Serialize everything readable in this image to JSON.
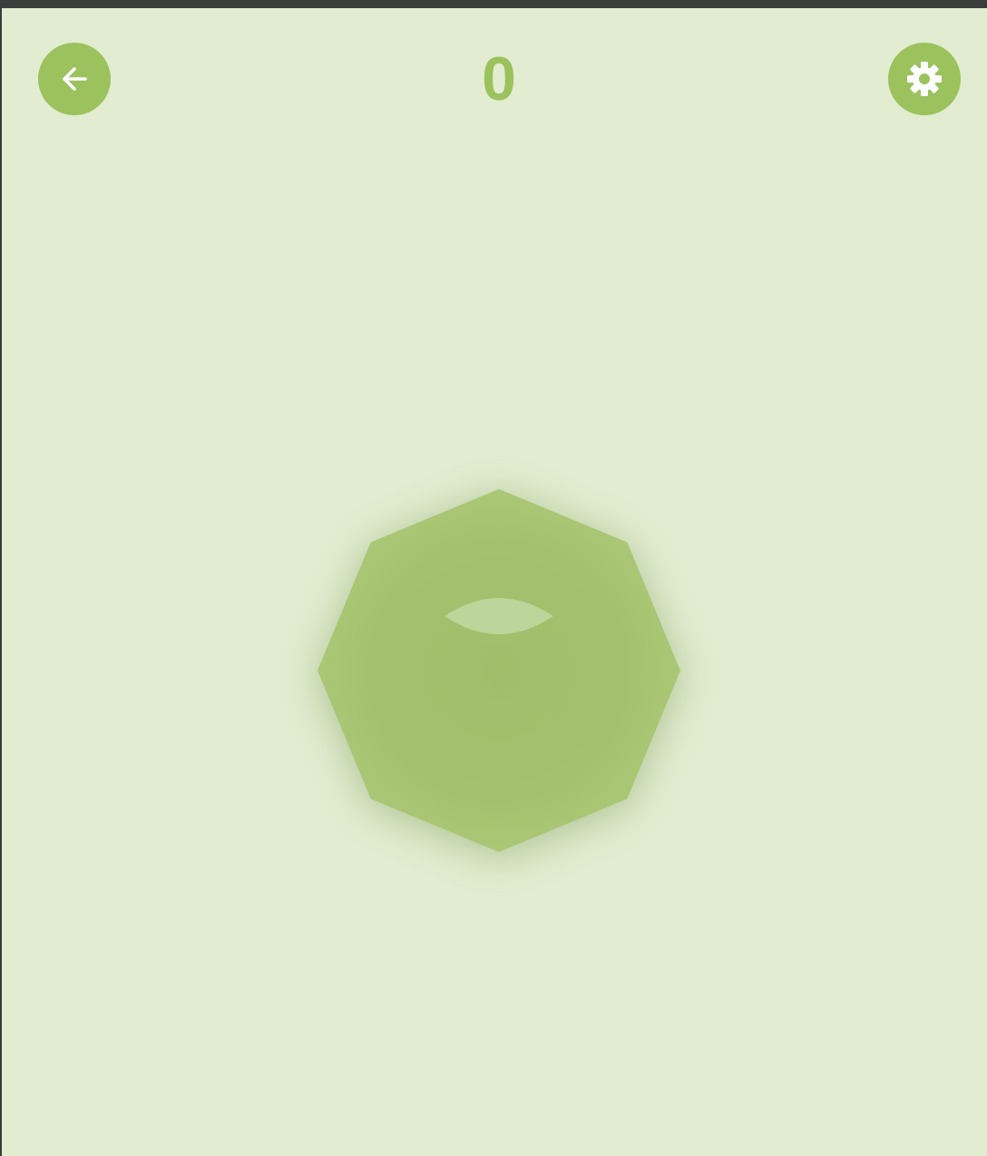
{
  "score": {
    "value": "0"
  },
  "buttons": {
    "back": {
      "icon": "arrow-left-icon"
    },
    "settings": {
      "icon": "gear-icon"
    }
  },
  "shape": {
    "type": "octagon",
    "eye": "lens-shape"
  },
  "colors": {
    "background": "#e1ecd0",
    "accent": "#9bc25d",
    "shape_fill": "#a3c16e",
    "eye_fill": "#bcd59a",
    "frame": "#3b3e3b"
  }
}
